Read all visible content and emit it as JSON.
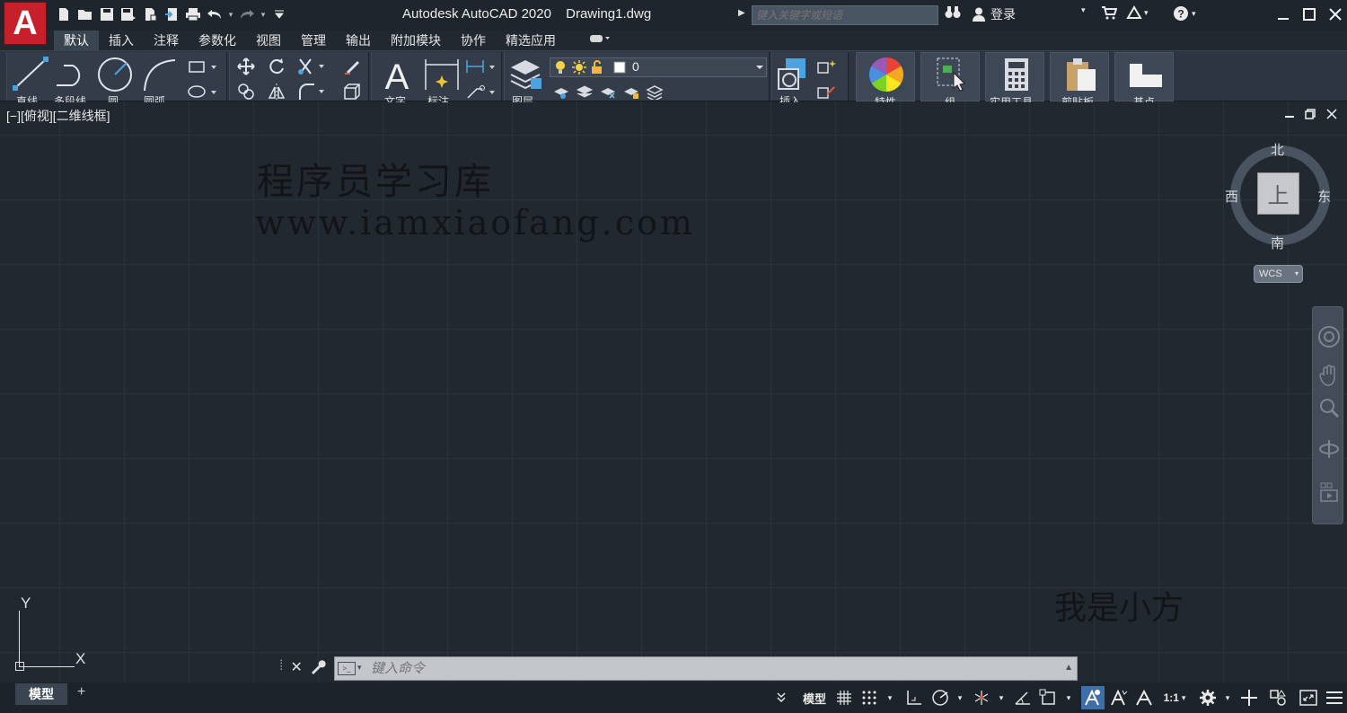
{
  "app": {
    "logo_letter": "A",
    "title": "Autodesk AutoCAD 2020",
    "document": "Drawing1.dwg",
    "search_placeholder": "键入关键字或短语",
    "sign_in": "登录",
    "accent_color": "#c8202a"
  },
  "quick_access": [
    "new-icon",
    "open-icon",
    "save-icon",
    "save-as-icon",
    "plot-preview-icon",
    "share-icon",
    "print-icon",
    "undo-icon",
    "redo-icon",
    "customize-icon"
  ],
  "menu_tabs": [
    {
      "label": "默认",
      "active": true
    },
    {
      "label": "插入"
    },
    {
      "label": "注释"
    },
    {
      "label": "参数化"
    },
    {
      "label": "视图"
    },
    {
      "label": "管理"
    },
    {
      "label": "输出"
    },
    {
      "label": "附加模块"
    },
    {
      "label": "协作"
    },
    {
      "label": "精选应用"
    }
  ],
  "ribbon": {
    "draw": {
      "line": "直线",
      "polyline": "多段线",
      "circle": "圆",
      "arc": "圆弧"
    },
    "annotation": {
      "text": "文字",
      "dimension": "标注"
    },
    "layers": {
      "label": "图层",
      "current_layer": "0"
    },
    "block": {
      "insert": "插入"
    },
    "properties": "特性",
    "groups": "组",
    "utilities": "实用工具",
    "clipboard": "剪贴板",
    "view": "基点"
  },
  "viewport": {
    "label": "[−][俯视][二维线框]",
    "watermark_title": "程序员学习库",
    "watermark_url": "www.iamxiaofang.com",
    "watermark_author": "我是小方"
  },
  "viewcube": {
    "face": "上",
    "north": "北",
    "south": "南",
    "east": "东",
    "west": "西",
    "wcs": "WCS"
  },
  "ucs": {
    "x": "X",
    "y": "Y"
  },
  "command": {
    "placeholder": "键入命令"
  },
  "status": {
    "layout_tab": "模型",
    "model_button": "模型",
    "scale": "1:1"
  }
}
